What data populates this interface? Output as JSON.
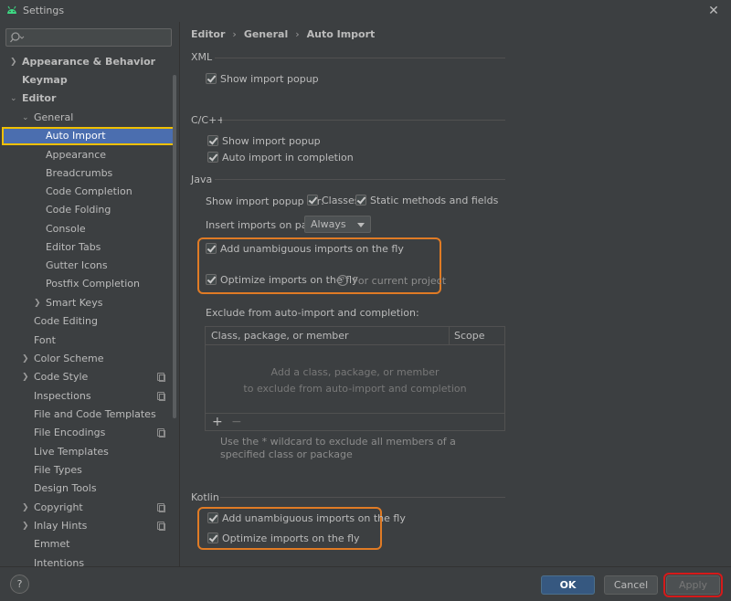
{
  "window": {
    "title": "Settings"
  },
  "colors": {
    "selection": "#4b6eaf",
    "highlight_yellow": "#f0c000",
    "highlight_orange": "#e07b25",
    "highlight_red": "#d51a1a",
    "ok_button": "#365880"
  },
  "sidebar": {
    "search_placeholder": "",
    "items": [
      {
        "label": "Appearance & Behavior",
        "arrow": "›"
      },
      {
        "label": "Keymap"
      },
      {
        "label": "Editor",
        "arrow": "⌄"
      },
      {
        "label": "General",
        "arrow": "⌄"
      },
      {
        "label": "Auto Import",
        "selected": true
      },
      {
        "label": "Appearance"
      },
      {
        "label": "Breadcrumbs"
      },
      {
        "label": "Code Completion"
      },
      {
        "label": "Code Folding"
      },
      {
        "label": "Console"
      },
      {
        "label": "Editor Tabs"
      },
      {
        "label": "Gutter Icons"
      },
      {
        "label": "Postfix Completion"
      },
      {
        "label": "Smart Keys",
        "arrow": "›"
      },
      {
        "label": "Code Editing"
      },
      {
        "label": "Font"
      },
      {
        "label": "Color Scheme",
        "arrow": "›"
      },
      {
        "label": "Code Style",
        "arrow": "›"
      },
      {
        "label": "Inspections"
      },
      {
        "label": "File and Code Templates"
      },
      {
        "label": "File Encodings"
      },
      {
        "label": "Live Templates"
      },
      {
        "label": "File Types"
      },
      {
        "label": "Design Tools"
      },
      {
        "label": "Copyright",
        "arrow": "›"
      },
      {
        "label": "Inlay Hints",
        "arrow": "›"
      },
      {
        "label": "Emmet"
      },
      {
        "label": "Intentions"
      }
    ]
  },
  "breadcrumb": [
    "Editor",
    "General",
    "Auto Import"
  ],
  "xml": {
    "title": "XML",
    "show_import_popup": {
      "label": "Show import popup",
      "checked": true
    }
  },
  "cpp": {
    "title": "C/C++",
    "show_import_popup": {
      "label": "Show import popup",
      "checked": true
    },
    "auto_import_completion": {
      "label": "Auto import in completion",
      "checked": true
    }
  },
  "java": {
    "title": "Java",
    "show_popup_for": "Show import popup for:",
    "classes": {
      "label": "Classes",
      "checked": true
    },
    "static_methods": {
      "label": "Static methods and fields",
      "checked": true
    },
    "insert_on_paste_label": "Insert imports on paste:",
    "insert_on_paste_value": "Always",
    "add_unambiguous": {
      "label": "Add unambiguous imports on the fly",
      "checked": true
    },
    "optimize": {
      "label": "Optimize imports on the fly",
      "checked": true
    },
    "optimize_hint": "For current project",
    "exclude_title": "Exclude from auto-import and completion:",
    "table": {
      "col1": "Class, package, or member",
      "col2": "Scope",
      "empty_line1": "Add a class, package, or member",
      "empty_line2": "to exclude from auto-import and completion",
      "add": "+",
      "remove": "−"
    },
    "wildcard_note": "Use the * wildcard to exclude all members of a specified class or package"
  },
  "kotlin": {
    "title": "Kotlin",
    "add_unambiguous": {
      "label": "Add unambiguous imports on the fly",
      "checked": true
    },
    "optimize": {
      "label": "Optimize imports on the fly",
      "checked": true
    }
  },
  "footer": {
    "help": "?",
    "ok": "OK",
    "cancel": "Cancel",
    "apply": "Apply"
  }
}
